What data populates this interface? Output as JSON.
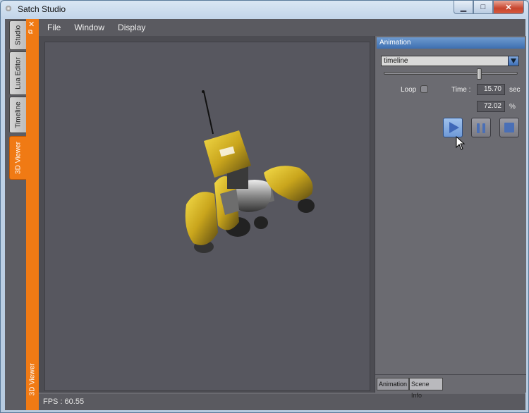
{
  "window": {
    "title": "Satch Studio",
    "controls": [
      "minimize",
      "maximize",
      "close"
    ]
  },
  "side_tabs": [
    {
      "label": "Studio"
    },
    {
      "label": "Lua Editor"
    },
    {
      "label": "Timeline"
    },
    {
      "label": "3D Viewer"
    }
  ],
  "dock": {
    "label": "3D Viewer"
  },
  "menu": {
    "file": "File",
    "window": "Window",
    "display": "Display"
  },
  "status": {
    "fps": "FPS : 60.55"
  },
  "animation": {
    "header": "Animation",
    "dropdown_value": "timeline",
    "slider_fraction": 0.72,
    "loop_label": "Loop",
    "time_label": "Time :",
    "time_value": "15.70",
    "time_unit": "sec",
    "percent_value": "72.02",
    "percent_unit": "%"
  },
  "bottom_tabs": {
    "animation": "Animation",
    "scene_info": "Scene Info"
  },
  "colors": {
    "accent_orange": "#f07a14",
    "header_blue": "#3d6fb0",
    "viewport": "#57575f"
  }
}
